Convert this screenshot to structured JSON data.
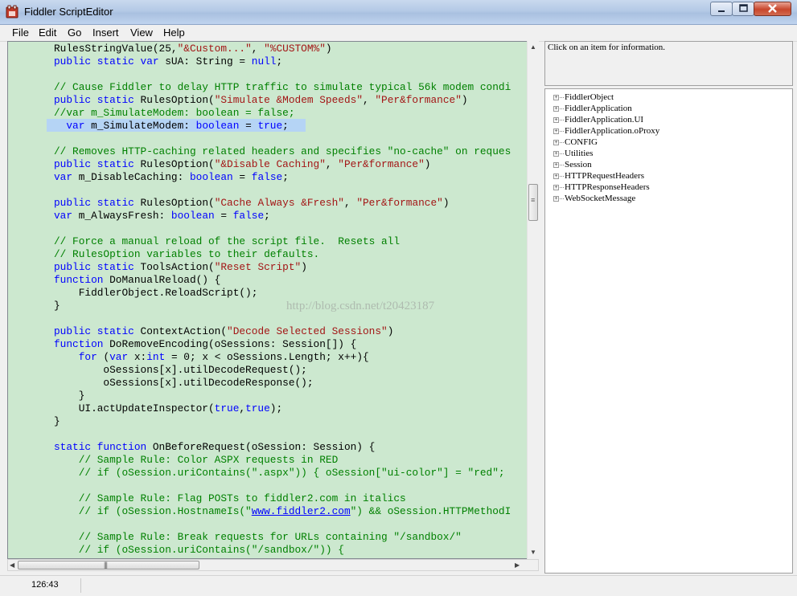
{
  "window": {
    "title": "Fiddler ScriptEditor",
    "controls": {
      "minimize": "−",
      "maximize": "□",
      "close": "✕"
    }
  },
  "menu": [
    "File",
    "Edit",
    "Go",
    "Insert",
    "View",
    "Help"
  ],
  "editor": {
    "background": "#cce8cf",
    "lines": [
      [
        {
          "t": "RulesStringValue(25,",
          "c": "p"
        },
        {
          "t": "\"&Custom...\"",
          "c": "str"
        },
        {
          "t": ", ",
          "c": "p"
        },
        {
          "t": "\"%CUSTOM%\"",
          "c": "str"
        },
        {
          "t": ")",
          "c": "p"
        }
      ],
      [
        {
          "t": "public static var",
          "c": "kw"
        },
        {
          "t": " sUA: String = ",
          "c": "p"
        },
        {
          "t": "null",
          "c": "kw"
        },
        {
          "t": ";",
          "c": "p"
        }
      ],
      [],
      [
        {
          "t": "// Cause Fiddler to delay HTTP traffic to simulate typical 56k modem condi",
          "c": "cm"
        }
      ],
      [
        {
          "t": "public static",
          "c": "kw"
        },
        {
          "t": " RulesOption(",
          "c": "p"
        },
        {
          "t": "\"Simulate &Modem Speeds\"",
          "c": "str"
        },
        {
          "t": ", ",
          "c": "p"
        },
        {
          "t": "\"Per&formance\"",
          "c": "str"
        },
        {
          "t": ")",
          "c": "p"
        }
      ],
      [
        {
          "t": "//var m_SimulateModem: boolean = false;",
          "c": "cm"
        }
      ],
      [
        {
          "t": "  var",
          "c": "kw"
        },
        {
          "t": " m_SimulateModem: ",
          "c": "p"
        },
        {
          "t": "boolean",
          "c": "kw"
        },
        {
          "t": " = ",
          "c": "p"
        },
        {
          "t": "true",
          "c": "kw"
        },
        {
          "t": ";",
          "c": "p"
        }
      ],
      [],
      [
        {
          "t": "// Removes HTTP-caching related headers and specifies \"no-cache\" on reques",
          "c": "cm"
        }
      ],
      [
        {
          "t": "public static",
          "c": "kw"
        },
        {
          "t": " RulesOption(",
          "c": "p"
        },
        {
          "t": "\"&Disable Caching\"",
          "c": "str"
        },
        {
          "t": ", ",
          "c": "p"
        },
        {
          "t": "\"Per&formance\"",
          "c": "str"
        },
        {
          "t": ")",
          "c": "p"
        }
      ],
      [
        {
          "t": "var",
          "c": "kw"
        },
        {
          "t": " m_DisableCaching: ",
          "c": "p"
        },
        {
          "t": "boolean",
          "c": "kw"
        },
        {
          "t": " = ",
          "c": "p"
        },
        {
          "t": "false",
          "c": "kw"
        },
        {
          "t": ";",
          "c": "p"
        }
      ],
      [],
      [
        {
          "t": "public static",
          "c": "kw"
        },
        {
          "t": " RulesOption(",
          "c": "p"
        },
        {
          "t": "\"Cache Always &Fresh\"",
          "c": "str"
        },
        {
          "t": ", ",
          "c": "p"
        },
        {
          "t": "\"Per&formance\"",
          "c": "str"
        },
        {
          "t": ")",
          "c": "p"
        }
      ],
      [
        {
          "t": "var",
          "c": "kw"
        },
        {
          "t": " m_AlwaysFresh: ",
          "c": "p"
        },
        {
          "t": "boolean",
          "c": "kw"
        },
        {
          "t": " = ",
          "c": "p"
        },
        {
          "t": "false",
          "c": "kw"
        },
        {
          "t": ";",
          "c": "p"
        }
      ],
      [],
      [
        {
          "t": "// Force a manual reload of the script file.  Resets all",
          "c": "cm"
        }
      ],
      [
        {
          "t": "// RulesOption variables to their defaults.",
          "c": "cm"
        }
      ],
      [
        {
          "t": "public static",
          "c": "kw"
        },
        {
          "t": " ToolsAction(",
          "c": "p"
        },
        {
          "t": "\"Reset Script\"",
          "c": "str"
        },
        {
          "t": ")",
          "c": "p"
        }
      ],
      [
        {
          "t": "function",
          "c": "kw"
        },
        {
          "t": " DoManualReload() {",
          "c": "p"
        }
      ],
      [
        {
          "t": "    FiddlerObject.ReloadScript();",
          "c": "p"
        }
      ],
      [
        {
          "t": "}",
          "c": "p"
        }
      ],
      [],
      [
        {
          "t": "public static",
          "c": "kw"
        },
        {
          "t": " ContextAction(",
          "c": "p"
        },
        {
          "t": "\"Decode Selected Sessions\"",
          "c": "str"
        },
        {
          "t": ")",
          "c": "p"
        }
      ],
      [
        {
          "t": "function",
          "c": "kw"
        },
        {
          "t": " DoRemoveEncoding(oSessions: Session[]) {",
          "c": "p"
        }
      ],
      [
        {
          "t": "    ",
          "c": "p"
        },
        {
          "t": "for",
          "c": "kw"
        },
        {
          "t": " (",
          "c": "p"
        },
        {
          "t": "var",
          "c": "kw"
        },
        {
          "t": " x:",
          "c": "p"
        },
        {
          "t": "int",
          "c": "kw"
        },
        {
          "t": " = 0; x < oSessions.Length; x++){",
          "c": "p"
        }
      ],
      [
        {
          "t": "        oSessions[x].utilDecodeRequest();",
          "c": "p"
        }
      ],
      [
        {
          "t": "        oSessions[x].utilDecodeResponse();",
          "c": "p"
        }
      ],
      [
        {
          "t": "    }",
          "c": "p"
        }
      ],
      [
        {
          "t": "    UI.actUpdateInspector(",
          "c": "p"
        },
        {
          "t": "true",
          "c": "kw"
        },
        {
          "t": ",",
          "c": "p"
        },
        {
          "t": "true",
          "c": "kw"
        },
        {
          "t": ");",
          "c": "p"
        }
      ],
      [
        {
          "t": "}",
          "c": "p"
        }
      ],
      [],
      [
        {
          "t": "static function",
          "c": "kw"
        },
        {
          "t": " OnBeforeRequest(oSession: Session) {",
          "c": "p"
        }
      ],
      [
        {
          "t": "    // Sample Rule: Color ASPX requests in RED",
          "c": "cm"
        }
      ],
      [
        {
          "t": "    // if (oSession.uriContains(\".aspx\")) { oSession[\"ui-color\"] = \"red\";",
          "c": "cm"
        }
      ],
      [],
      [
        {
          "t": "    // Sample Rule: Flag POSTs to fiddler2.com in italics",
          "c": "cm"
        }
      ],
      [
        {
          "t": "    // if (oSession.HostnameIs(\"",
          "c": "cm"
        },
        {
          "t": "www.fiddler2.com",
          "c": "lnk"
        },
        {
          "t": "\") && oSession.HTTPMethodI",
          "c": "cm"
        }
      ],
      [],
      [
        {
          "t": "    // Sample Rule: Break requests for URLs containing \"/sandbox/\"",
          "c": "cm"
        }
      ],
      [
        {
          "t": "    // if (oSession.uriContains(\"/sandbox/\")) {",
          "c": "cm"
        }
      ]
    ],
    "watermark": "http://blog.csdn.net/t20423187"
  },
  "info_panel": {
    "text": "Click on an item for information."
  },
  "tree": [
    "FiddlerObject",
    "FiddlerApplication",
    "FiddlerApplication.UI",
    "FiddlerApplication.oProxy",
    "CONFIG",
    "Utilities",
    "Session",
    "HTTPRequestHeaders",
    "HTTPResponseHeaders",
    "WebSocketMessage"
  ],
  "status": {
    "position": "126:43"
  }
}
